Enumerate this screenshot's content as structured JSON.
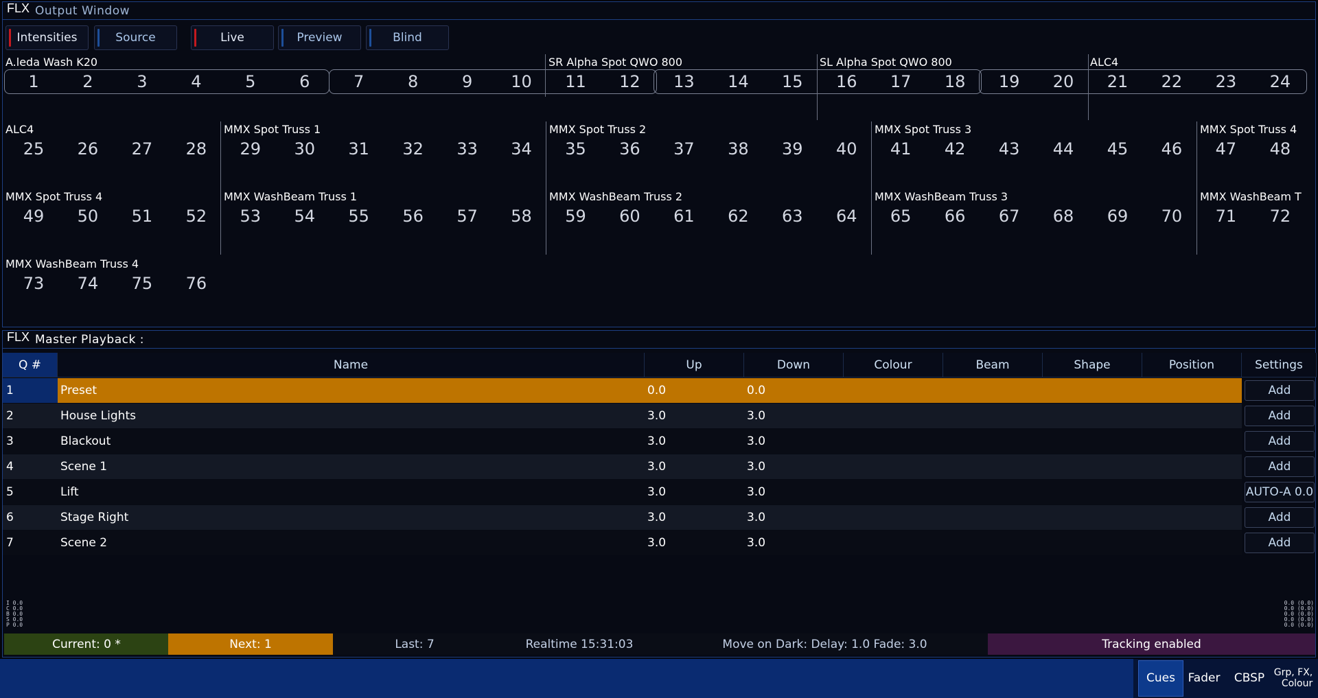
{
  "output_window": {
    "logo": "FLX",
    "title": "Output Window",
    "view_buttons": [
      {
        "label": "Intensities",
        "accent": "#c4191e"
      },
      {
        "label": "Source",
        "accent": "#1d4f9a"
      },
      {
        "label": "Live",
        "accent": "#c4191e"
      },
      {
        "label": "Preview",
        "accent": "#1d4f9a"
      },
      {
        "label": "Blind",
        "accent": "#1d4f9a"
      }
    ],
    "fixture_groups": [
      {
        "label": "A.leda  Wash  K20"
      },
      {
        "label": "SR  Alpha  Spot  QWO  800"
      },
      {
        "label": "SL  Alpha  Spot  QWO  800"
      },
      {
        "label": "ALC4"
      },
      {
        "label": "ALC4"
      },
      {
        "label": "MMX  Spot  Truss  1"
      },
      {
        "label": "MMX  Spot  Truss  2"
      },
      {
        "label": "MMX  Spot  Truss  3"
      },
      {
        "label": "MMX  Spot  Truss  4"
      },
      {
        "label": "MMX  Spot  Truss  4"
      },
      {
        "label": "MMX  WashBeam  Truss  1"
      },
      {
        "label": "MMX  WashBeam  Truss  2"
      },
      {
        "label": "MMX  WashBeam  Truss  3"
      },
      {
        "label": "MMX  WashBeam  T"
      },
      {
        "label": "MMX  WashBeam  Truss  4"
      }
    ],
    "channels": [
      "1",
      "2",
      "3",
      "4",
      "5",
      "6",
      "7",
      "8",
      "9",
      "10",
      "11",
      "12",
      "13",
      "14",
      "15",
      "16",
      "17",
      "18",
      "19",
      "20",
      "21",
      "22",
      "23",
      "24",
      "25",
      "26",
      "27",
      "28",
      "29",
      "30",
      "31",
      "32",
      "33",
      "34",
      "35",
      "36",
      "37",
      "38",
      "39",
      "40",
      "41",
      "42",
      "43",
      "44",
      "45",
      "46",
      "47",
      "48",
      "49",
      "50",
      "51",
      "52",
      "53",
      "54",
      "55",
      "56",
      "57",
      "58",
      "59",
      "60",
      "61",
      "62",
      "63",
      "64",
      "65",
      "66",
      "67",
      "68",
      "69",
      "70",
      "71",
      "72",
      "73",
      "74",
      "75",
      "76"
    ]
  },
  "master_playback": {
    "logo": "FLX",
    "title": "Master Playback :",
    "columns": {
      "q": "Q #",
      "name": "Name",
      "up": "Up",
      "down": "Down",
      "colour": "Colour",
      "beam": "Beam",
      "shape": "Shape",
      "position": "Position",
      "settings": "Settings"
    },
    "cues": [
      {
        "q": "1",
        "name": "Preset",
        "up": "0.0",
        "down": "0.0",
        "settings": "Add"
      },
      {
        "q": "2",
        "name": "House  Lights",
        "up": "3.0",
        "down": "3.0",
        "settings": "Add"
      },
      {
        "q": "3",
        "name": "Blackout",
        "up": "3.0",
        "down": "3.0",
        "settings": "Add"
      },
      {
        "q": "4",
        "name": "Scene  1",
        "up": "3.0",
        "down": "3.0",
        "settings": "Add"
      },
      {
        "q": "5",
        "name": "Lift",
        "up": "3.0",
        "down": "3.0",
        "settings": "AUTO-A  0.0"
      },
      {
        "q": "6",
        "name": "Stage  Right",
        "up": "3.0",
        "down": "3.0",
        "settings": "Add"
      },
      {
        "q": "7",
        "name": "Scene  2",
        "up": "3.0",
        "down": "3.0",
        "settings": "Add"
      }
    ],
    "mini_left": [
      "I",
      "C",
      "B",
      "S",
      "P"
    ],
    "mini_left_vals": [
      "0.0",
      "0.0",
      "0.0",
      "0.0",
      "0.0"
    ],
    "mini_right": [
      "0.0 (0.0)",
      "0.0 (0.0)",
      "0.0 (0.0)",
      "0.0 (0.0)",
      "0.0 (0.0)"
    ],
    "status": {
      "current": "Current: 0 *",
      "next": "Next: 1",
      "last": "Last: 7",
      "realtime": "Realtime  15:31:03",
      "move_on_dark": "Move  on  Dark:  Delay:  1.0    Fade:  3.0",
      "tracking": "Tracking  enabled"
    },
    "colors": {
      "current_bg": "#2c4313",
      "next_bg": "#be7400",
      "tracking_bg": "#3b1740",
      "selected_row": "#be7400"
    }
  },
  "bottom_tabs": [
    {
      "label": "Cues"
    },
    {
      "label": "Fader"
    },
    {
      "label": "CBSP"
    },
    {
      "label": "Grp,  FX,\nColour"
    }
  ]
}
